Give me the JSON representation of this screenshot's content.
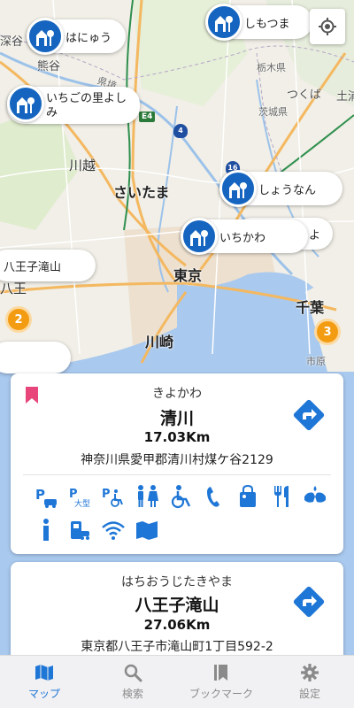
{
  "map": {
    "labels": {
      "fukaya": "深谷",
      "kumagaya": "熊谷",
      "kawagoe": "川越",
      "saitama": "さいたま",
      "tokyo": "東京",
      "kawasaki": "川崎",
      "chiba": "千葉",
      "tsukuba": "つくば",
      "tsuchiura": "土浦",
      "ichihara": "市原",
      "hachioji_short": "八王",
      "prefecture_border_a": "県境",
      "prefecture_border_b": "栃木県",
      "prefecture_border_c": "茨城県"
    },
    "road_badges": {
      "e4": "E4",
      "r4": "4",
      "r16": "16"
    },
    "markers": [
      {
        "id": "hanyu",
        "label": "はにゅう"
      },
      {
        "id": "shimotsuma",
        "label": "しもつま"
      },
      {
        "id": "ichigo",
        "label": "いちごの里よしみ"
      },
      {
        "id": "shonan",
        "label": "しょうなん"
      },
      {
        "id": "ichikawa",
        "label": "いちかわ"
      }
    ],
    "pills": {
      "hachioji": "八王子滝山",
      "behind_ichikawa": "よ"
    },
    "clusters": {
      "left": "2",
      "right": "3"
    },
    "colors": {
      "marker": "#1565c0",
      "cluster": "#f39c12",
      "water": "#a9c9ee",
      "park": "#c8e6b0"
    }
  },
  "cards": [
    {
      "kana": "きよかわ",
      "name": "清川",
      "distance": "17.03Km",
      "address": "神奈川県愛甲郡清川村煤ケ谷2129",
      "bookmarked": true,
      "facilities": [
        "parking-car-icon",
        "parking-large-icon",
        "parking-accessible-icon",
        "restroom-icon",
        "wheelchair-icon",
        "phone-icon",
        "shop-icon",
        "restaurant-icon",
        "handwash-icon",
        "info-icon",
        "ev-charger-icon",
        "wifi-icon",
        "map-icon"
      ]
    },
    {
      "kana": "はちおうじたきやま",
      "name": "八王子滝山",
      "distance": "27.06Km",
      "address": "東京都八王子市滝山町1丁目592-2",
      "bookmarked": false
    }
  ],
  "nav": [
    {
      "label": "マップ",
      "icon": "map-icon",
      "active": true
    },
    {
      "label": "検索",
      "icon": "search-icon",
      "active": false
    },
    {
      "label": "ブックマーク",
      "icon": "bookmark-icon",
      "active": false
    },
    {
      "label": "設定",
      "icon": "gear-icon",
      "active": false
    }
  ],
  "colors": {
    "accent": "#1e76d6",
    "bookmark": "#e8467a",
    "facility": "#1e76d6"
  }
}
